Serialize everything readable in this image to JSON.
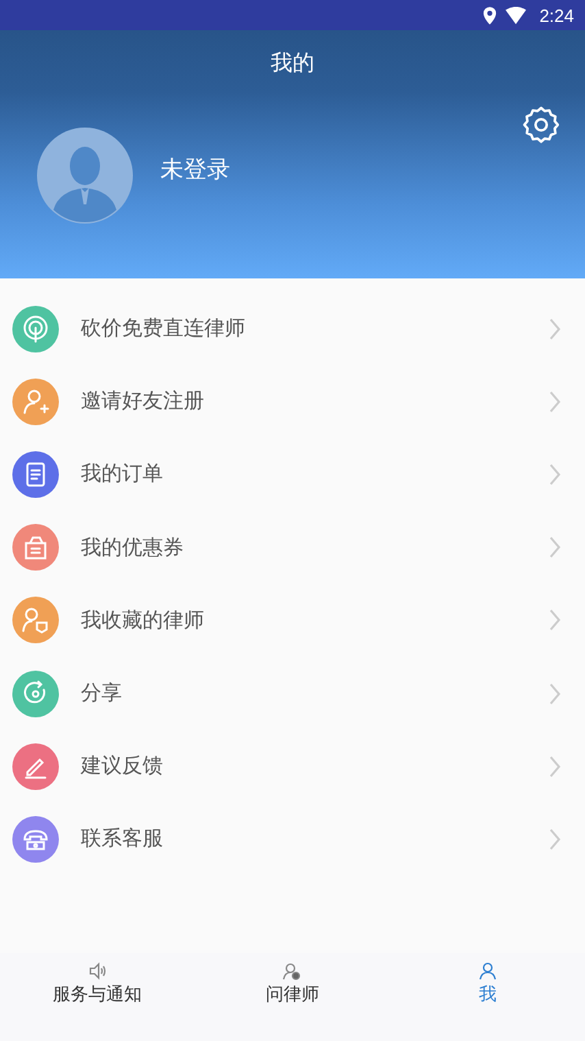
{
  "status_bar": {
    "time": "2:24"
  },
  "header": {
    "title": "我的",
    "user_name": "未登录"
  },
  "menu": [
    {
      "label": "砍价免费直连律师",
      "kind": "signal",
      "color": "#4fc3a1"
    },
    {
      "label": "邀请好友注册",
      "kind": "add-user",
      "color": "#f0a055"
    },
    {
      "label": "我的订单",
      "kind": "document",
      "color": "#5d6fe8"
    },
    {
      "label": "我的优惠券",
      "kind": "coupon",
      "color": "#f0887a"
    },
    {
      "label": "我收藏的律师",
      "kind": "saved-user",
      "color": "#f0a055"
    },
    {
      "label": "分享",
      "kind": "share",
      "color": "#4fc3a1"
    },
    {
      "label": "建议反馈",
      "kind": "pen",
      "color": "#ec7082"
    },
    {
      "label": "联系客服",
      "kind": "phone",
      "color": "#8f86ee"
    }
  ],
  "tabs": [
    {
      "label": "服务与通知",
      "kind": "speaker",
      "selected": false
    },
    {
      "label": "问律师",
      "kind": "lawyer",
      "selected": false
    },
    {
      "label": "我",
      "kind": "person",
      "selected": true
    }
  ]
}
